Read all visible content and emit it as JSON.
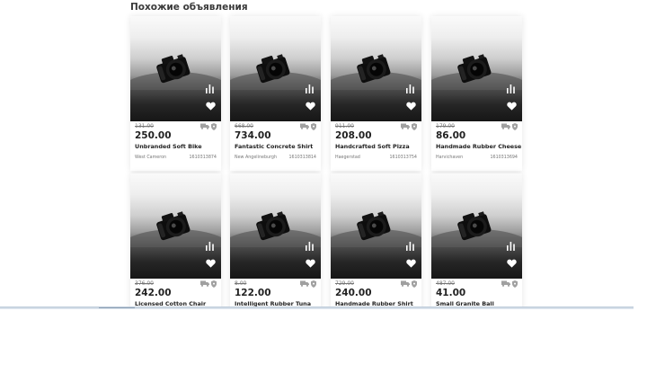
{
  "section": {
    "title": "Похожие объявления"
  },
  "colors": {
    "text": "#222222",
    "muted": "#777777",
    "icon": "#9a9a9a",
    "card_shadow": "rgba(0,0,0,0.10)"
  },
  "icons": {
    "image": "camera-photo",
    "stats": "bar-chart-icon",
    "favorite": "heart-icon",
    "delivery": "truck-icon",
    "guard": "shield-icon"
  },
  "listings": [
    {
      "old_price": "131.00",
      "price": "250.00",
      "title": "Unbranded Soft Bike",
      "location": "West Cameron",
      "id": "1610313874"
    },
    {
      "old_price": "668.00",
      "price": "734.00",
      "title": "Fantastic Concrete Shirt",
      "location": "New Angelineburgh",
      "id": "1610313814"
    },
    {
      "old_price": "911.00",
      "price": "208.00",
      "title": "Handcrafted Soft Pizza",
      "location": "Haegerstad",
      "id": "1610313754"
    },
    {
      "old_price": "179.00",
      "price": "86.00",
      "title": "Handmade Rubber Cheese",
      "location": "Harvichaven",
      "id": "1610313694"
    },
    {
      "old_price": "376.00",
      "price": "242.00",
      "title": "Licensed Cotton Chair",
      "location": "",
      "id": ""
    },
    {
      "old_price": "8.00",
      "price": "122.00",
      "title": "Intelligent Rubber Tuna",
      "location": "",
      "id": ""
    },
    {
      "old_price": "729.00",
      "price": "240.00",
      "title": "Handmade Rubber Shirt",
      "location": "",
      "id": ""
    },
    {
      "old_price": "487.00",
      "price": "41.00",
      "title": "Small Granite Ball",
      "location": "",
      "id": ""
    }
  ]
}
